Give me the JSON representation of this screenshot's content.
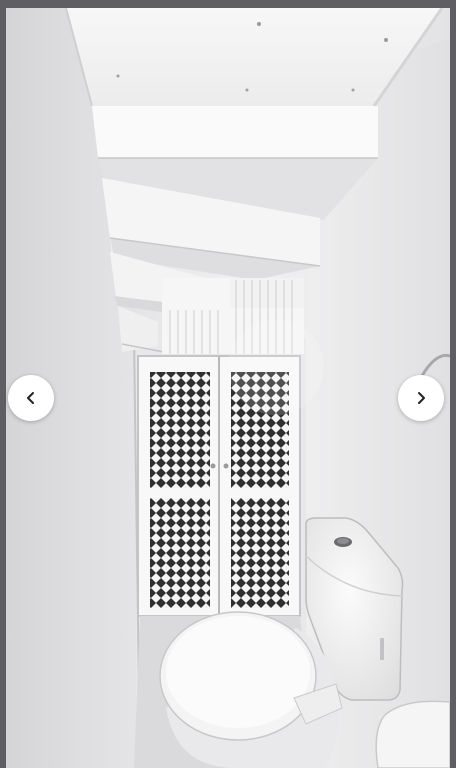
{
  "gallery": {
    "image_alt": "",
    "icons": {
      "prev": "chevron-left-icon",
      "next": "chevron-right-icon"
    },
    "colors": {
      "page_background": "#5f5f63",
      "nav_button": "#ffffff",
      "nav_icon": "#222222"
    }
  }
}
